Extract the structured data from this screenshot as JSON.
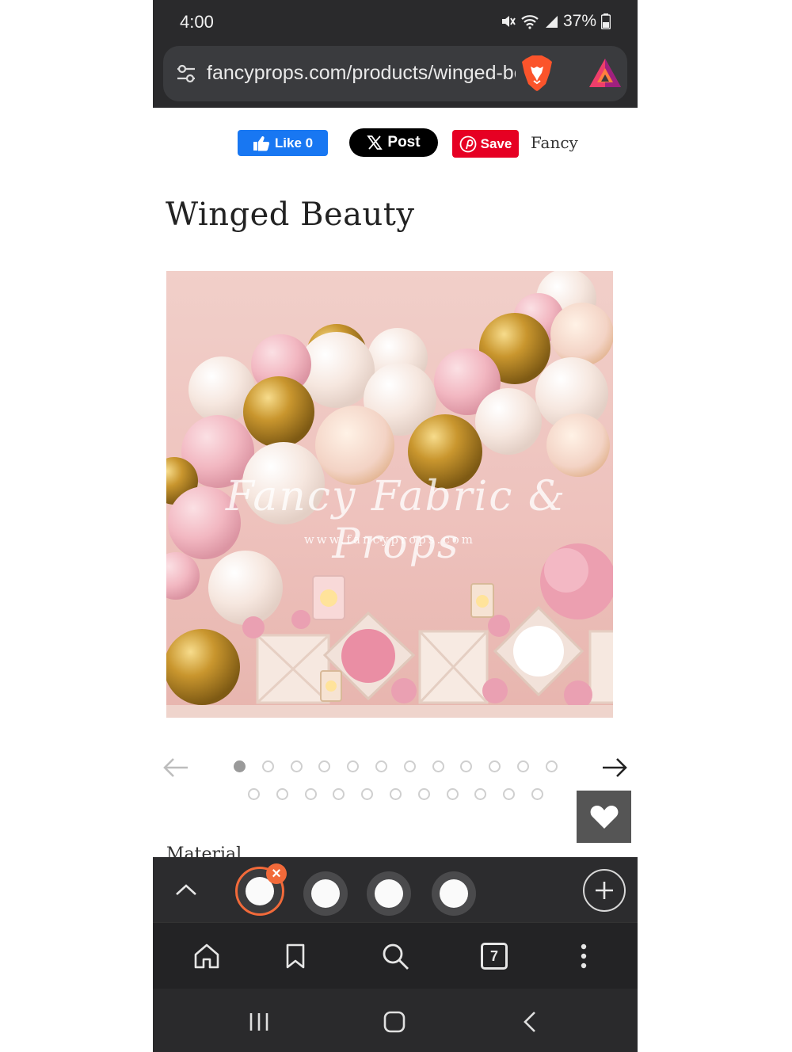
{
  "status": {
    "time": "4:00",
    "battery": "37%"
  },
  "browser": {
    "url": "fancyprops.com/products/winged-beauty",
    "tab_count": "7"
  },
  "share": {
    "like_label": "Like 0",
    "post_label": "Post",
    "save_label": "Save",
    "fancy_label": "Fancy"
  },
  "product": {
    "title": "Winged Beauty",
    "image_watermark": "Fancy Fabric & Props",
    "image_watermark_url": "www.fancyprops.com",
    "next_section_label": "Material"
  },
  "gallery": {
    "total_images": 23,
    "current_index": 1
  },
  "colors": {
    "accent_tab": "#f26a3a",
    "facebook": "#1877f2",
    "pinterest": "#e60023",
    "browser_dark": "#2a2a2c"
  },
  "icons": [
    "settings-sliders-icon",
    "brave-lion-icon",
    "brave-rewards-icon",
    "thumbs-up-icon",
    "x-logo-icon",
    "pinterest-icon",
    "arrow-left-icon",
    "arrow-right-icon",
    "heart-icon",
    "chevron-up-icon",
    "plus-icon",
    "home-icon",
    "bookmark-icon",
    "search-icon",
    "more-vertical-icon",
    "recents-icon",
    "home-pill-icon",
    "back-icon"
  ]
}
